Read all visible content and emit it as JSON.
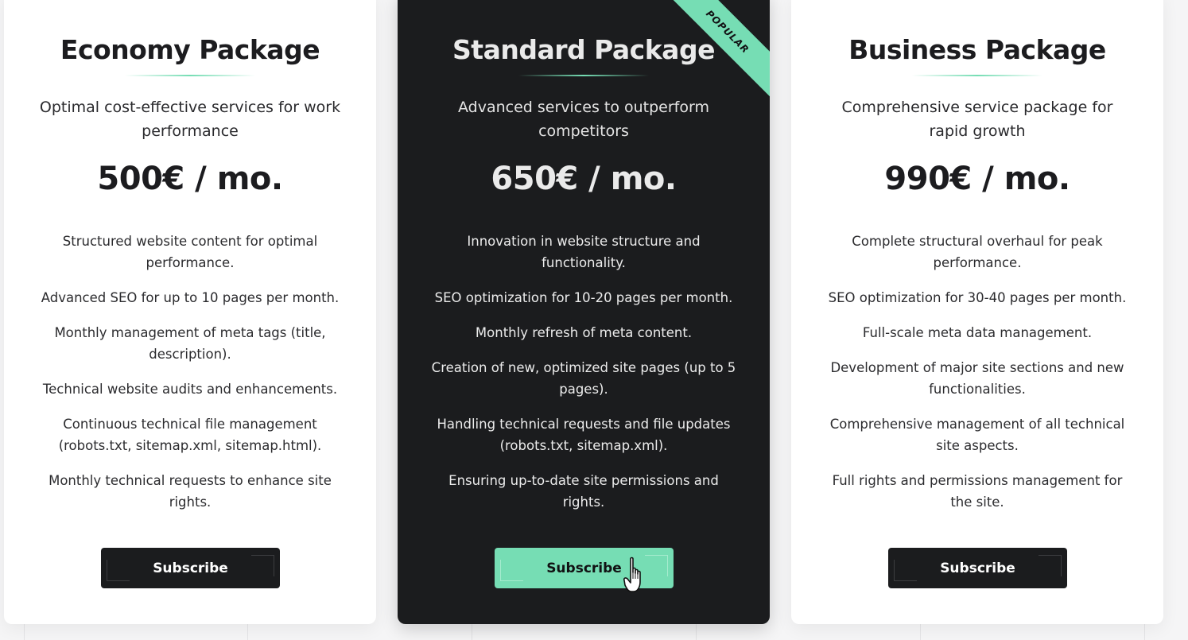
{
  "colors": {
    "accent": "#76ddb4",
    "dark_card": "#1b1c1e",
    "light_card": "#ffffff"
  },
  "plans": [
    {
      "title": "Economy Package",
      "description": "Optimal cost-effective services for work performance",
      "price": "500€ / mo.",
      "features": [
        "Structured website content for optimal performance.",
        "Advanced SEO for up to 10 pages per month.",
        "Monthly management of meta tags (title, description).",
        "Technical website audits and enhancements.",
        "Continuous technical file management (robots.txt, sitemap.xml, sitemap.html).",
        "Monthly technical requests to enhance site rights."
      ],
      "button_label": "Subscribe"
    },
    {
      "title": "Standard Package",
      "badge": "POPULAR",
      "description": "Advanced services to outperform competitors",
      "price": "650€ / mo.",
      "features": [
        "Innovation in website structure and functionality.",
        "SEO optimization for 10-20 pages per month.",
        "Monthly refresh of meta content.",
        "Creation of new, optimized site pages (up to 5 pages).",
        "Handling technical requests and file updates (robots.txt, sitemap.xml).",
        "Ensuring up-to-date site permissions and rights."
      ],
      "button_label": "Subscribe"
    },
    {
      "title": "Business Package",
      "description": "Comprehensive service package for rapid growth",
      "price": "990€ / mo.",
      "features": [
        "Complete structural overhaul for peak performance.",
        "SEO optimization for 30-40 pages per month.",
        "Full-scale meta data management.",
        "Development of major site sections and new functionalities.",
        "Comprehensive management of all technical site aspects.",
        "Full rights and permissions management for the site."
      ],
      "button_label": "Subscribe"
    }
  ]
}
